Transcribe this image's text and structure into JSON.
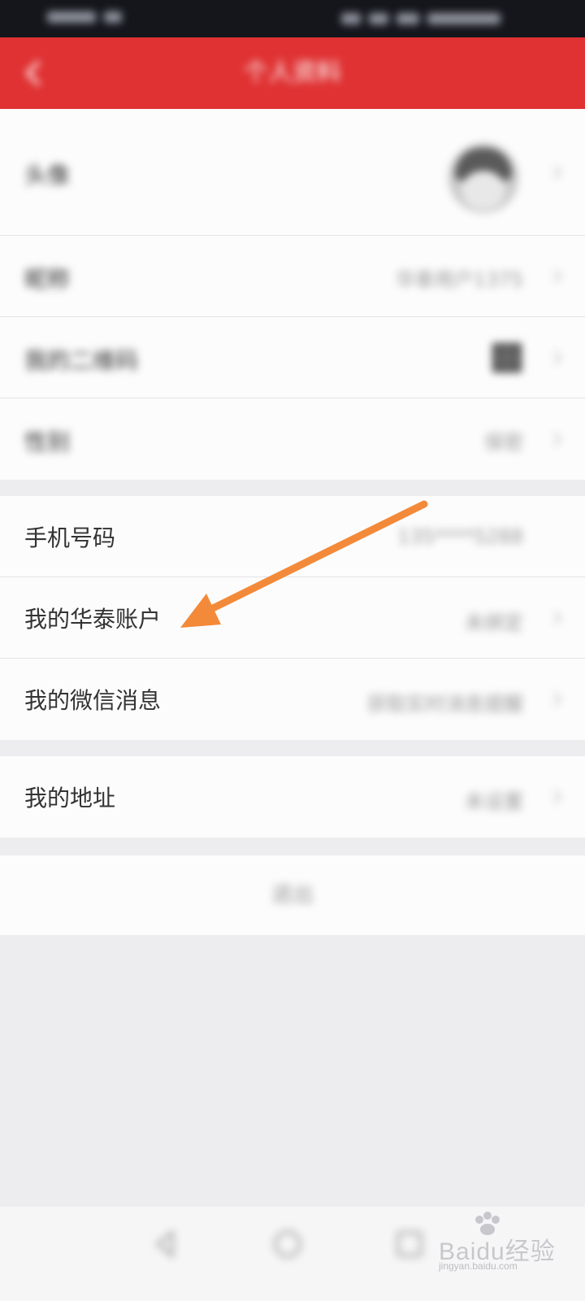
{
  "colors": {
    "accent": "#e03233",
    "arrow": "#f38a3a",
    "status_bar": "#14161c",
    "page_bg": "#ededf0",
    "row_bg": "#fcfcfc",
    "watermark": "#c8c8cc"
  },
  "app_bar": {
    "back_icon": "back-arrow-icon",
    "title": "个人资料"
  },
  "profile": {
    "avatar_label": "头像",
    "nickname_label": "昵称",
    "nickname_value": "华泰用户1375",
    "qr_label": "我的二维码",
    "qr_icon": "qr-code-icon",
    "gender_label": "性别",
    "gender_value": "保密"
  },
  "account": {
    "phone_label": "手机号码",
    "phone_value": "135****5288",
    "htsc_label": "我的华泰账户",
    "htsc_value": "未绑定",
    "wechat_label": "我的微信消息",
    "wechat_value": "获取实时消息提醒"
  },
  "address": {
    "label": "我的地址",
    "value": "未设置"
  },
  "logout_label": "退出",
  "nav": {
    "back_icon": "nav-back-icon",
    "home_icon": "nav-home-icon",
    "recent_icon": "nav-recent-icon"
  },
  "watermark": {
    "text": "Baidu经验",
    "sub": "jingyan.baidu.com"
  }
}
